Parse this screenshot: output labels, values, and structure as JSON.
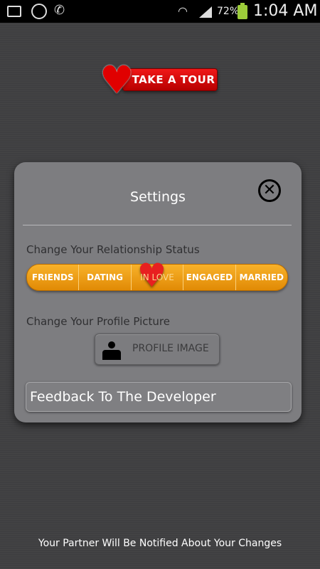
{
  "status_bar": {
    "battery_percent": "72%",
    "time": "1:04 AM",
    "icons": [
      "gallery-icon",
      "whatsapp-icon",
      "phone-call-icon",
      "wifi-icon",
      "signal-icon",
      "battery-icon"
    ]
  },
  "tour": {
    "label": "TAKE A TOUR"
  },
  "dialog": {
    "title": "Settings",
    "relationship_label": "Change Your Relationship Status",
    "statuses": [
      "FRIENDS",
      "DATING",
      "IN LOVE",
      "ENGAGED",
      "MARRIED"
    ],
    "selected_status": "IN LOVE",
    "profile_label": "Change Your Profile Picture",
    "profile_button": "PROFILE IMAGE",
    "feedback_button": "Feedback To The Developer"
  },
  "footer": {
    "note": "Your Partner Will Be Notified About Your Changes"
  },
  "colors": {
    "accent_orange": "#f0a020",
    "heart_red": "#e00000",
    "dialog_bg": "#7d7d80"
  }
}
